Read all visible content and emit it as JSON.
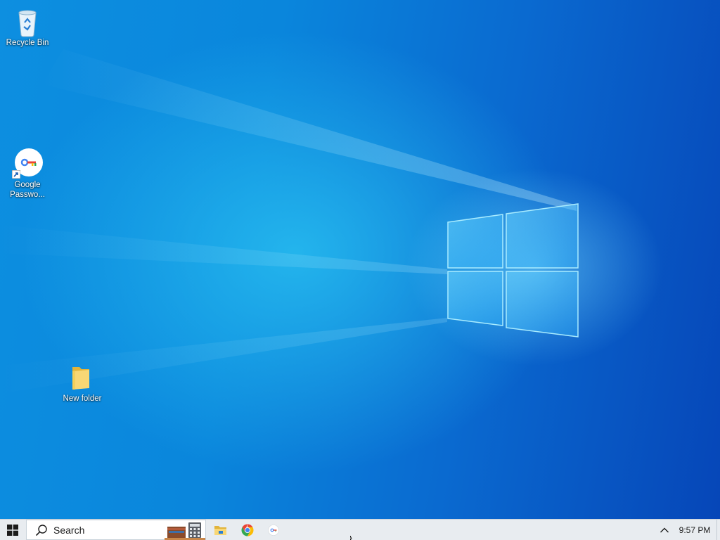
{
  "desktop": {
    "icons": [
      {
        "label": "Recycle Bin",
        "icon": "recycle-bin-icon"
      },
      {
        "label": "Google\nPasswo...",
        "icon": "google-password-manager-icon"
      },
      {
        "label": "New folder",
        "icon": "folder-icon"
      }
    ],
    "wallpaper": "windows-logo-light-beams"
  },
  "taskbar": {
    "start_icon": "windows-logo-icon",
    "search": {
      "placeholder": "Search",
      "icon": "search-icon"
    },
    "apps": [
      {
        "name": "File Explorer",
        "icon": "file-explorer-icon"
      },
      {
        "name": "Google Chrome",
        "icon": "chrome-icon"
      },
      {
        "name": "Google Password Manager",
        "icon": "google-password-manager-icon"
      }
    ],
    "tray_chevron_icon": "chevron-up-icon",
    "clock": "9:57 PM"
  },
  "colors": {
    "accent": "#0a78d7",
    "taskbar_bg": "#e8ecf0",
    "folder_yellow": "#f4cf58",
    "chrome_red": "#ea4335",
    "chrome_green": "#34a853",
    "chrome_yellow": "#fbbc05",
    "chrome_blue": "#4285f4"
  }
}
